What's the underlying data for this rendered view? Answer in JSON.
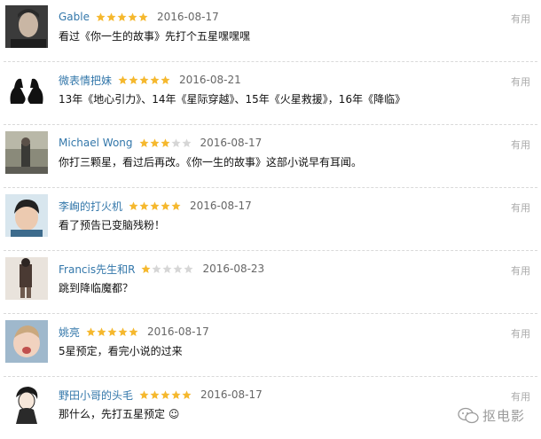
{
  "colors": {
    "username": "#3377aa",
    "star_filled": "#f5b82e",
    "star_empty": "#d6d6d6",
    "date": "#666666",
    "useful": "#aaaaaa"
  },
  "reviews": [
    {
      "username": "Gable",
      "rating": 5,
      "date": "2016-08-17",
      "content": "看过《你一生的故事》先打个五星嘿嘿嘿",
      "useful": "有用",
      "avatar": "man-portrait"
    },
    {
      "username": "微表情把妹",
      "rating": 5,
      "date": "2016-08-21",
      "content": "13年《地心引力》、14年《星际穿越》、15年《火星救援》，16年《降临》",
      "useful": "有用",
      "avatar": "hands-gesture"
    },
    {
      "username": "Michael Wong",
      "rating": 3,
      "date": "2016-08-17",
      "content": "你打三颗星，看过后再改。《你一生的故事》这部小说早有耳闻。",
      "useful": "有用",
      "avatar": "street-scene"
    },
    {
      "username": "李峋的打火机",
      "rating": 5,
      "date": "2016-08-17",
      "content": "看了预告已变脑残粉！",
      "useful": "有用",
      "avatar": "boy-portrait"
    },
    {
      "username": "Francis先生和R",
      "rating": 1,
      "date": "2016-08-23",
      "content": "跳到降临魔都？",
      "useful": "有用",
      "avatar": "person-standing"
    },
    {
      "username": "姚亮",
      "rating": 5,
      "date": "2016-08-17",
      "content": "5星预定，看完小说的过来",
      "useful": "有用",
      "avatar": "baby-portrait"
    },
    {
      "username": "野田小哥的头毛",
      "rating": 5,
      "date": "2016-08-17",
      "content": "那什么，先打五星预定 ☺",
      "useful": "有用",
      "avatar": "cartoon-character"
    }
  ],
  "watermark": {
    "text": "抠电影",
    "icon": "wechat-icon"
  }
}
